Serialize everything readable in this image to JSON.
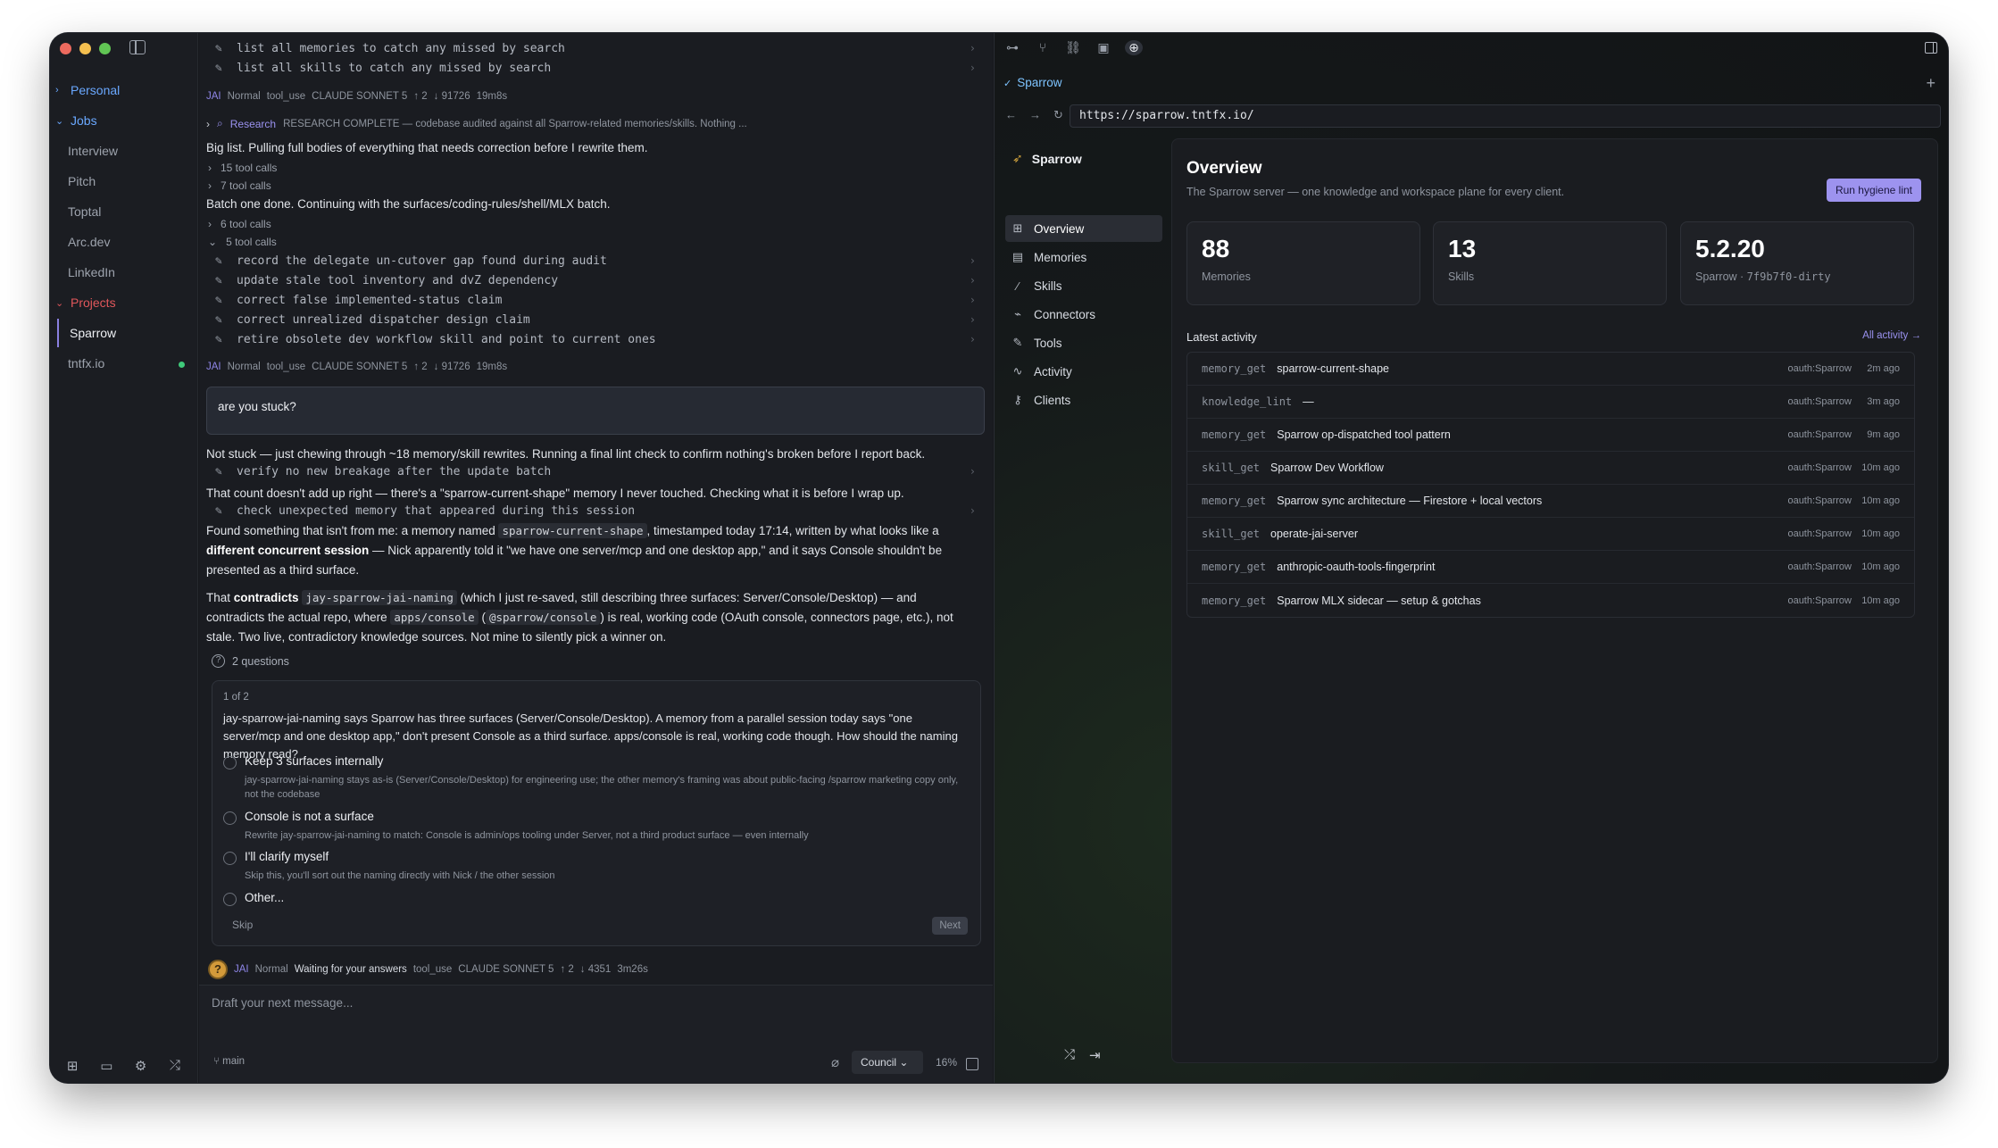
{
  "sidebar": {
    "sections": [
      {
        "label": "Personal",
        "color": "#6aa8ff",
        "collapsed": true
      },
      {
        "label": "Jobs",
        "color": "#6aa8ff",
        "collapsed": false
      },
      {
        "label": "Projects",
        "color": "#e0575b",
        "collapsed": false
      }
    ],
    "jobs": [
      "Interview",
      "Pitch",
      "Toptal",
      "Arc.dev",
      "LinkedIn"
    ],
    "projects": [
      "Sparrow",
      "tntfx.io"
    ],
    "bottom_icons": [
      "new-chat-icon",
      "folder-icon",
      "gear-icon",
      "shuffle-icon"
    ]
  },
  "chat": {
    "top_tools": [
      "list all memories to catch any missed by search",
      "list all skills to catch any missed by search"
    ],
    "meta1": {
      "agent": "JAI",
      "mode": "Normal",
      "kind": "tool_use",
      "model": "CLAUDE SONNET 5",
      "up": "↑ 2",
      "down": "↓ 91726",
      "time": "19m8s"
    },
    "research": {
      "label": "Research",
      "text": "RESEARCH COMPLETE — codebase audited against all Sparrow-related memories/skills. Nothing ..."
    },
    "para1": "Big list. Pulling full bodies of everything that needs correction before I rewrite them.",
    "calls1": [
      "15 tool calls",
      "7 tool calls"
    ],
    "para2": "Batch one done. Continuing with the surfaces/coding-rules/shell/MLX batch.",
    "calls2": [
      "6 tool calls",
      "5 tool calls"
    ],
    "batch_tools": [
      "record the delegate un-cutover gap found during audit",
      "update stale tool inventory and dvZ dependency",
      "correct false implemented-status claim",
      "correct unrealized dispatcher design claim",
      "retire obsolete dev workflow skill and point to current ones"
    ],
    "meta2": {
      "agent": "JAI",
      "mode": "Normal",
      "kind": "tool_use",
      "model": "CLAUDE SONNET 5",
      "up": "↑ 2",
      "down": "↓ 91726",
      "time": "19m8s"
    },
    "user_message": "are you stuck?",
    "reply1": "Not stuck — just chewing through ~18 memory/skill rewrites. Running a final lint check to confirm nothing's broken before I report back.",
    "tool_verify": "verify no new breakage after the update batch",
    "reply2": "That count doesn't add up right — there's a \"sparrow-current-shape\" memory I never touched. Checking what it is before I wrap up.",
    "tool_check": "check unexpected memory that appeared during this session",
    "reply3": {
      "a": "Found something that isn't from me: a memory named ",
      "code1": "sparrow-current-shape",
      "b": ", timestamped today 17:14, written by what looks like a ",
      "bold1": "different concurrent session",
      "c": " — Nick apparently told it \"we have one server/mcp and one desktop app,\" and it says Console shouldn't be presented as a third surface."
    },
    "reply4": {
      "a": "That ",
      "bold1": "contradicts",
      "code1": "jay-sparrow-jai-naming",
      "b": " (which I just re-saved, still describing three surfaces: Server/Console/Desktop) — and contradicts the actual repo, where ",
      "code2": "apps/console",
      "c": " (",
      "code3": "@sparrow/console",
      "d": ") is real, working code (OAuth console, connectors page, etc.), not stale. Two live, contradictory knowledge sources. Not mine to silently pick a winner on."
    },
    "questions_label": "2 questions",
    "question": {
      "counter": "1 of 2",
      "text": "jay-sparrow-jai-naming says Sparrow has three surfaces (Server/Console/Desktop). A memory from a parallel session today says \"one server/mcp and one desktop app,\" don't present Console as a third surface. apps/console is real, working code though. How should the naming memory read?",
      "options": [
        {
          "title": "Keep 3 surfaces internally",
          "desc": "jay-sparrow-jai-naming stays as-is (Server/Console/Desktop) for engineering use; the other memory's framing was about public-facing /sparrow marketing copy only, not the codebase"
        },
        {
          "title": "Console is not a surface",
          "desc": "Rewrite jay-sparrow-jai-naming to match: Console is admin/ops tooling under Server, not a third product surface — even internally"
        },
        {
          "title": "I'll clarify myself",
          "desc": "Skip this, you'll sort out the naming directly with Nick / the other session"
        },
        {
          "title": "Other...",
          "desc": ""
        }
      ],
      "skip": "Skip",
      "next": "Next"
    },
    "meta3": {
      "agent": "JAI",
      "mode": "Normal",
      "status": "Waiting for your answers",
      "kind": "tool_use",
      "model": "CLAUDE SONNET 5",
      "up": "↑ 2",
      "down": "↓ 4351",
      "time": "3m26s"
    },
    "composer": {
      "placeholder": "Draft your next message...",
      "branch": "main",
      "mode": "Council",
      "percent": "16%"
    }
  },
  "browser": {
    "tab": "Sparrow",
    "url": "https://sparrow.tntfx.io/",
    "app_title": "Sparrow",
    "nav": [
      {
        "label": "Overview",
        "icon": "grid-icon"
      },
      {
        "label": "Memories",
        "icon": "database-icon"
      },
      {
        "label": "Skills",
        "icon": "wand-icon"
      },
      {
        "label": "Connectors",
        "icon": "plug-icon"
      },
      {
        "label": "Tools",
        "icon": "wrench-icon"
      },
      {
        "label": "Activity",
        "icon": "activity-icon"
      },
      {
        "label": "Clients",
        "icon": "key-icon"
      }
    ],
    "overview": {
      "title": "Overview",
      "subtitle": "The Sparrow server — one knowledge and workspace plane for every client.",
      "button": "Run hygiene lint",
      "stats": [
        {
          "value": "88",
          "label": "Memories"
        },
        {
          "value": "13",
          "label": "Skills"
        },
        {
          "value": "5.2.20",
          "label": "Sparrow · ",
          "label_code": "7f9b7f0-dirty"
        }
      ],
      "activity_title": "Latest activity",
      "activity_link": "All activity →",
      "activity": [
        {
          "op": "memory_get",
          "name": "sparrow-current-shape",
          "who": "oauth:Sparrow",
          "when": "2m ago"
        },
        {
          "op": "knowledge_lint",
          "name": "—",
          "who": "oauth:Sparrow",
          "when": "3m ago"
        },
        {
          "op": "memory_get",
          "name": "Sparrow op-dispatched tool pattern",
          "who": "oauth:Sparrow",
          "when": "9m ago"
        },
        {
          "op": "skill_get",
          "name": "Sparrow Dev Workflow",
          "who": "oauth:Sparrow",
          "when": "10m ago"
        },
        {
          "op": "memory_get",
          "name": "Sparrow sync architecture — Firestore + local vectors",
          "who": "oauth:Sparrow",
          "when": "10m ago"
        },
        {
          "op": "skill_get",
          "name": "operate-jai-server",
          "who": "oauth:Sparrow",
          "when": "10m ago"
        },
        {
          "op": "memory_get",
          "name": "anthropic-oauth-tools-fingerprint",
          "who": "oauth:Sparrow",
          "when": "10m ago"
        },
        {
          "op": "memory_get",
          "name": "Sparrow MLX sidecar — setup & gotchas",
          "who": "oauth:Sparrow",
          "when": "10m ago"
        }
      ]
    }
  }
}
